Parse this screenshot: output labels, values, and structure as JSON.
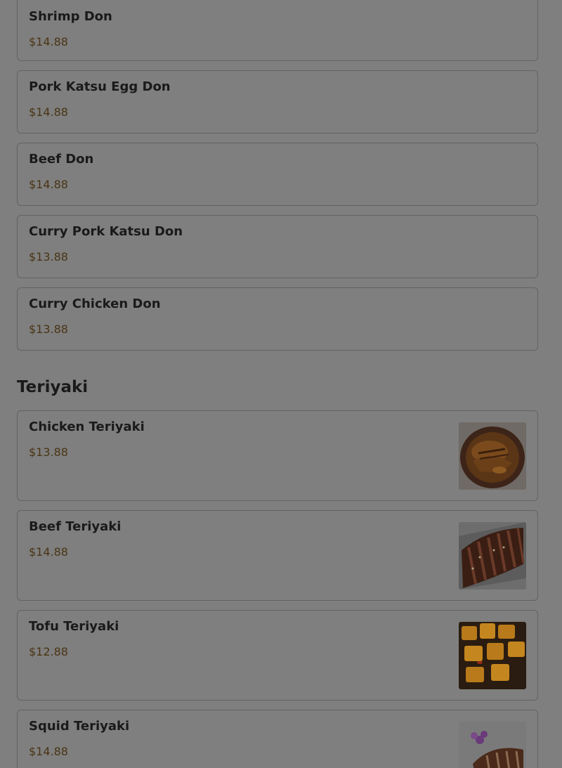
{
  "don_items": [
    {
      "name": "Shrimp Don",
      "price": "$14.88"
    },
    {
      "name": "Pork Katsu Egg Don",
      "price": "$14.88"
    },
    {
      "name": "Beef Don",
      "price": "$14.88"
    },
    {
      "name": "Curry Pork Katsu Don",
      "price": "$13.88"
    },
    {
      "name": "Curry Chicken Don",
      "price": "$13.88"
    }
  ],
  "teriyaki": {
    "title": "Teriyaki",
    "items": [
      {
        "name": "Chicken Teriyaki",
        "price": "$13.88",
        "image": "chicken-teriyaki-photo"
      },
      {
        "name": "Beef Teriyaki",
        "price": "$14.88",
        "image": "beef-teriyaki-photo"
      },
      {
        "name": "Tofu Teriyaki",
        "price": "$12.88",
        "image": "tofu-teriyaki-photo"
      },
      {
        "name": "Squid Teriyaki",
        "price": "$14.88",
        "image": "squid-teriyaki-photo"
      }
    ]
  },
  "colors": {
    "overlay_background": "#7f7f7f",
    "card_border": "#626262",
    "text": "#1a1a1a",
    "price_text": "#4a3515"
  }
}
